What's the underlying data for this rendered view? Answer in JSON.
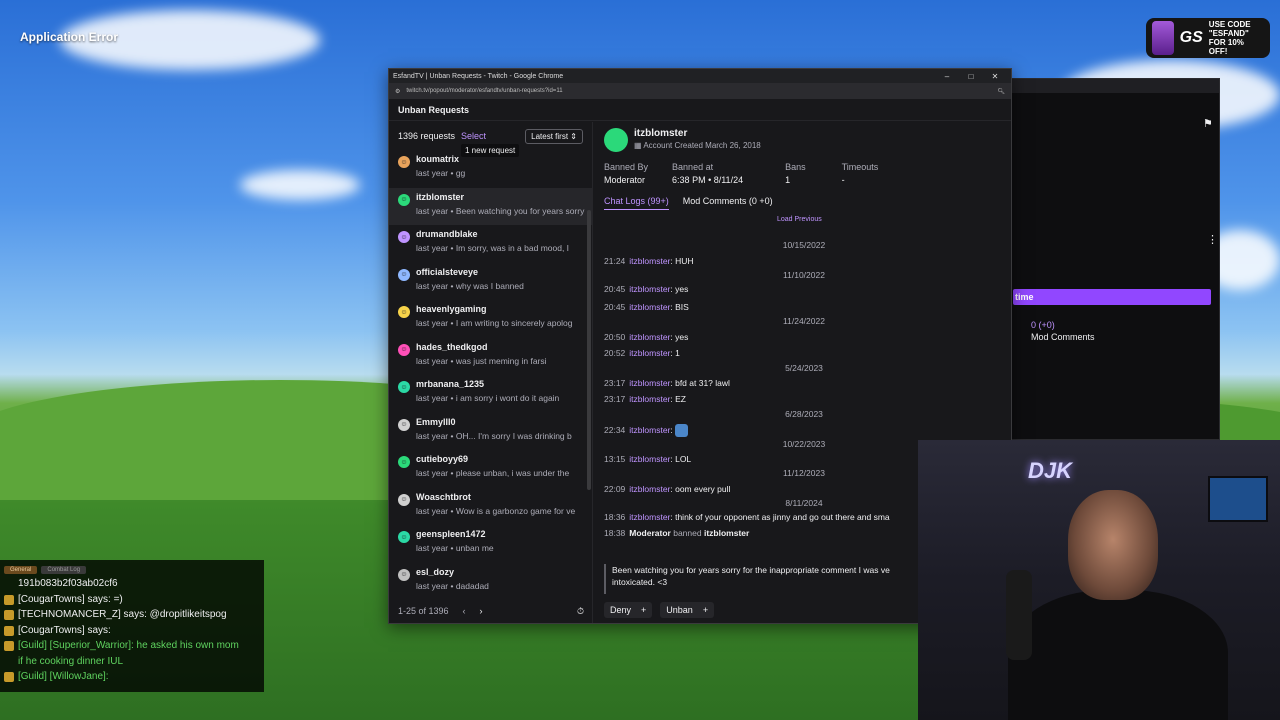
{
  "desktop": {
    "app_error": "Application Error"
  },
  "sponsor": {
    "logo": "GS",
    "line1": "USE CODE",
    "line2": "\"ESFAND\"",
    "line3": "FOR 10% OFF!"
  },
  "browser": {
    "title": "EsfandTV | Unban Requests - Twitch - Google Chrome",
    "url": "twitch.tv/popout/moderator/esfandtv/unban-requests?id=11",
    "window_controls": {
      "minimize": "–",
      "maximize": "□",
      "close": "✕"
    }
  },
  "page": {
    "heading": "Unban Requests",
    "request_count": "1396 requests",
    "select_label": "Select",
    "sort_label": "Latest first",
    "new_request_tooltip": "1 new request",
    "pager": {
      "range": "1-25 of 1396",
      "prev": "‹",
      "next": "›"
    }
  },
  "requests": [
    {
      "name": "koumatrix",
      "sub": "last year • gg",
      "avatar_color": "#e8a35c"
    },
    {
      "name": "itzblomster",
      "sub": "last year • Been watching you for years sorry",
      "avatar_color": "#2bd97a"
    },
    {
      "name": "drumandblake",
      "sub": "last year • Im sorry, was in a bad mood, I",
      "avatar_color": "#bf94ff"
    },
    {
      "name": "officialsteveye",
      "sub": "last year • why was I banned",
      "avatar_color": "#8fb8ff"
    },
    {
      "name": "heavenlygaming",
      "sub": "last year • I am writing to sincerely apolog",
      "avatar_color": "#f7d34a"
    },
    {
      "name": "hades_thedkgod",
      "sub": "last year • was just meming in farsi",
      "avatar_color": "#ff4fb8"
    },
    {
      "name": "mrbanana_1235",
      "sub": "last year • i am sorry i wont do it again",
      "avatar_color": "#2bd9a5"
    },
    {
      "name": "Emmylll0",
      "sub": "last year • OH... I'm sorry I was drinking b",
      "avatar_color": "#d0d0d0"
    },
    {
      "name": "cutieboyy69",
      "sub": "last year • please unban, i was under the",
      "avatar_color": "#2bd97a"
    },
    {
      "name": "Woaschtbrot",
      "sub": "last year • Wow is a garbonzo game for ve",
      "avatar_color": "#cfcfcf"
    },
    {
      "name": "geenspleen1472",
      "sub": "last year • unban me",
      "avatar_color": "#2bd9a5"
    },
    {
      "name": "esl_dozy",
      "sub": "last year • dadadad",
      "avatar_color": "#c0c0c0"
    }
  ],
  "detail": {
    "username": "itzblomster",
    "created": "Account Created March 26, 2018",
    "stats": [
      {
        "label": "Banned By",
        "value": "Moderator"
      },
      {
        "label": "Banned at",
        "value": "6:38 PM • 8/11/24"
      },
      {
        "label": "Bans",
        "value": "1"
      },
      {
        "label": "Timeouts",
        "value": "-"
      }
    ],
    "tabs": [
      "Chat Logs (99+)",
      "Mod Comments (0 +0)"
    ],
    "load_previous": "Load Previous",
    "dates": [
      "10/15/2022",
      "11/10/2022",
      "11/24/2022",
      "5/24/2023",
      "6/28/2023",
      "10/22/2023",
      "11/12/2023",
      "8/11/2024"
    ],
    "logs": [
      {
        "time": "21:24",
        "user": "itzblomster",
        "msg": ": HUH"
      },
      {
        "time": "20:45",
        "user": "itzblomster",
        "msg": ": yes"
      },
      {
        "time": "20:45",
        "user": "itzblomster",
        "msg": ": BIS"
      },
      {
        "time": "20:50",
        "user": "itzblomster",
        "msg": ": yes"
      },
      {
        "time": "20:52",
        "user": "itzblomster",
        "msg": ": 1"
      },
      {
        "time": "23:17",
        "user": "itzblomster",
        "msg": ": bfd at 31? lawl"
      },
      {
        "time": "23:17",
        "user": "itzblomster",
        "msg": ": EZ"
      },
      {
        "time": "22:34",
        "user": "itzblomster",
        "msg": ":"
      },
      {
        "time": "13:15",
        "user": "itzblomster",
        "msg": ": LOL"
      },
      {
        "time": "22:09",
        "user": "itzblomster",
        "msg": ": oom every pull"
      },
      {
        "time": "18:36",
        "user": "itzblomster",
        "msg": ": think of your opponent as jinny and go out there and sma"
      }
    ],
    "ban_event": {
      "time": "18:38",
      "actor": "Moderator",
      "text": "banned",
      "target": "itzblomster"
    },
    "request_message": "Been watching you for years sorry for the inappropriate comment I was ve intoxicated. <3",
    "actions": {
      "deny": "Deny",
      "unban": "Unban",
      "plus": "+"
    }
  },
  "bg_window": {
    "button": "time",
    "count": "0 (+0)",
    "mod_comments": "Mod Comments"
  },
  "webcam": {
    "sign": "DJK"
  },
  "chat": {
    "tabs": [
      "General",
      "Combat Log"
    ],
    "lines": [
      {
        "text": "191b083b2f03ab02cf6",
        "kind": "hash"
      },
      {
        "text": "[CougarTowns] says: =)",
        "kind": "say"
      },
      {
        "text": "[TECHNOMANCER_Z] says: @dropitlikeitspog",
        "kind": "say"
      },
      {
        "text": "[CougarTowns] says:",
        "kind": "say"
      },
      {
        "text": "[Guild] [Superior_Warrior]: he asked his own mom",
        "kind": "guild"
      },
      {
        "text": "if he cooking dinner IUL",
        "kind": "guild-cont"
      },
      {
        "text": "[Guild] [WillowJane]:",
        "kind": "guild"
      }
    ]
  }
}
